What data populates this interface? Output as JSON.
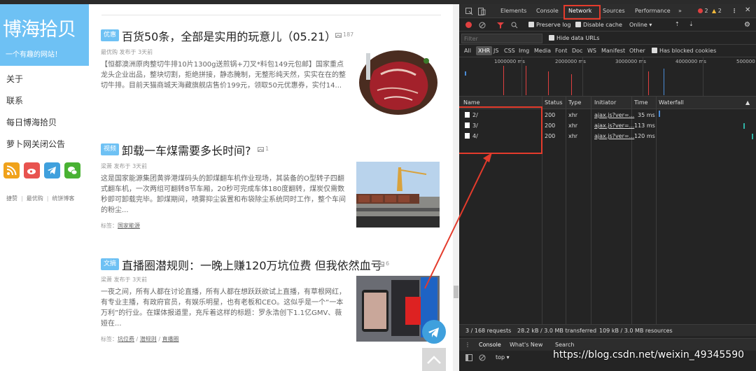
{
  "site": {
    "logo_title": "博海拾贝",
    "logo_slogan": "一个有趣的网站！",
    "nav": [
      "关于",
      "联系",
      "每日博海拾贝",
      "萝卜网关闭公告"
    ],
    "footer_links": [
      "捷赞",
      "最优购",
      "统饼博客"
    ],
    "footer_sep": "|"
  },
  "articles": [
    {
      "badge": "优惠",
      "title": "百货50条，全部是实用的玩意儿（05.21）",
      "img_count": "187",
      "meta": "最优购 发布于 3天前",
      "desc": "【恒都澳洲原肉整切牛排10片1300g送煎锅+刀叉*料包149元包邮】国家重点龙头企业出品，整块切割，拒绝拼接，静态腌制，无整形纯天然，实实在在的整切牛排。目前天猫商城天海藏旗舰店售价199元，领取50元优惠券，实付14...",
      "tags_label": "",
      "tags": []
    },
    {
      "badge": "视频",
      "title": "卸载一车煤需要多长时间?",
      "img_count": "1",
      "meta": "梁萧 发布于 3天前",
      "desc": "这是国家能源集团黄骅港煤码头的卸煤翻车机作业现场，其装备的O型转子四翻式翻车机，一次两组可翻转8节车厢，20秒可完成车体180度翻转，煤炭仅需数秒即可卸载完毕。卸煤期间，喷雾抑尘装置和布袋除尘系统同时工作，整个车间的粉尘...",
      "tags_label": "标签：",
      "tags": [
        "国家能源"
      ]
    },
    {
      "badge": "文摘",
      "title": "直播圈潜规则：一晚上赚120万坑位费 但我依然血亏",
      "img_count": "6",
      "meta": "梁萧 发布于 3天前",
      "desc": "一夜之间，所有人都在讨论直播，所有人都在想跃跃欲试上直播，有草根网红，有专业主播，有政府官员，有娱乐明星，也有老板和CEO。这似乎是一个“一本万利”的行业。在媒体报道里，充斥着这样的标题：罗永浩创下1.1亿GMV、薇娅在...",
      "tags_label": "标签：",
      "tags": [
        "坑位费",
        "潜规则",
        "直播圈"
      ]
    }
  ],
  "devtools": {
    "tabs": [
      "Elements",
      "Console",
      "Network",
      "Sources",
      "Performance",
      "»"
    ],
    "active_tab": "Network",
    "errors": "2",
    "warnings": "2",
    "toolbar": {
      "preserve_log": "Preserve log",
      "disable_cache": "Disable cache",
      "throttle": "Online"
    },
    "filter_placeholder": "Filter",
    "hide_data_urls": "Hide data URLs",
    "types": [
      "All",
      "XHR",
      "JS",
      "CSS",
      "Img",
      "Media",
      "Font",
      "Doc",
      "WS",
      "Manifest",
      "Other"
    ],
    "active_type": "XHR",
    "has_blocked_cookies": "Has blocked cookies",
    "timeline_ticks": [
      "1000000 ms",
      "2000000 ms",
      "3000000 ms",
      "4000000 ms",
      "500000"
    ],
    "columns": [
      "Name",
      "Status",
      "Type",
      "Initiator",
      "Time",
      "Waterfall"
    ],
    "rows": [
      {
        "name": "2/",
        "status": "200",
        "type": "xhr",
        "initiator": "ajax.js?ver=...",
        "time": "35 ms"
      },
      {
        "name": "3/",
        "status": "200",
        "type": "xhr",
        "initiator": "ajax.js?ver=...",
        "time": "113 ms"
      },
      {
        "name": "4/",
        "status": "200",
        "type": "xhr",
        "initiator": "ajax.js?ver=...",
        "time": "120 ms"
      }
    ],
    "status_bar": {
      "requests": "3 / 168 requests",
      "transferred": "28.2 kB / 3.0 MB transferred",
      "resources": "109 kB / 3.0 MB resources"
    },
    "drawer_tabs": [
      "Console",
      "What's New",
      "Search"
    ],
    "context": "top"
  },
  "watermark": "https://blog.csdn.net/weixin_49345590",
  "colors": {
    "accent": "#6ec1f4",
    "red_highlight": "#e43b2c",
    "devtools_bg": "#242424"
  }
}
